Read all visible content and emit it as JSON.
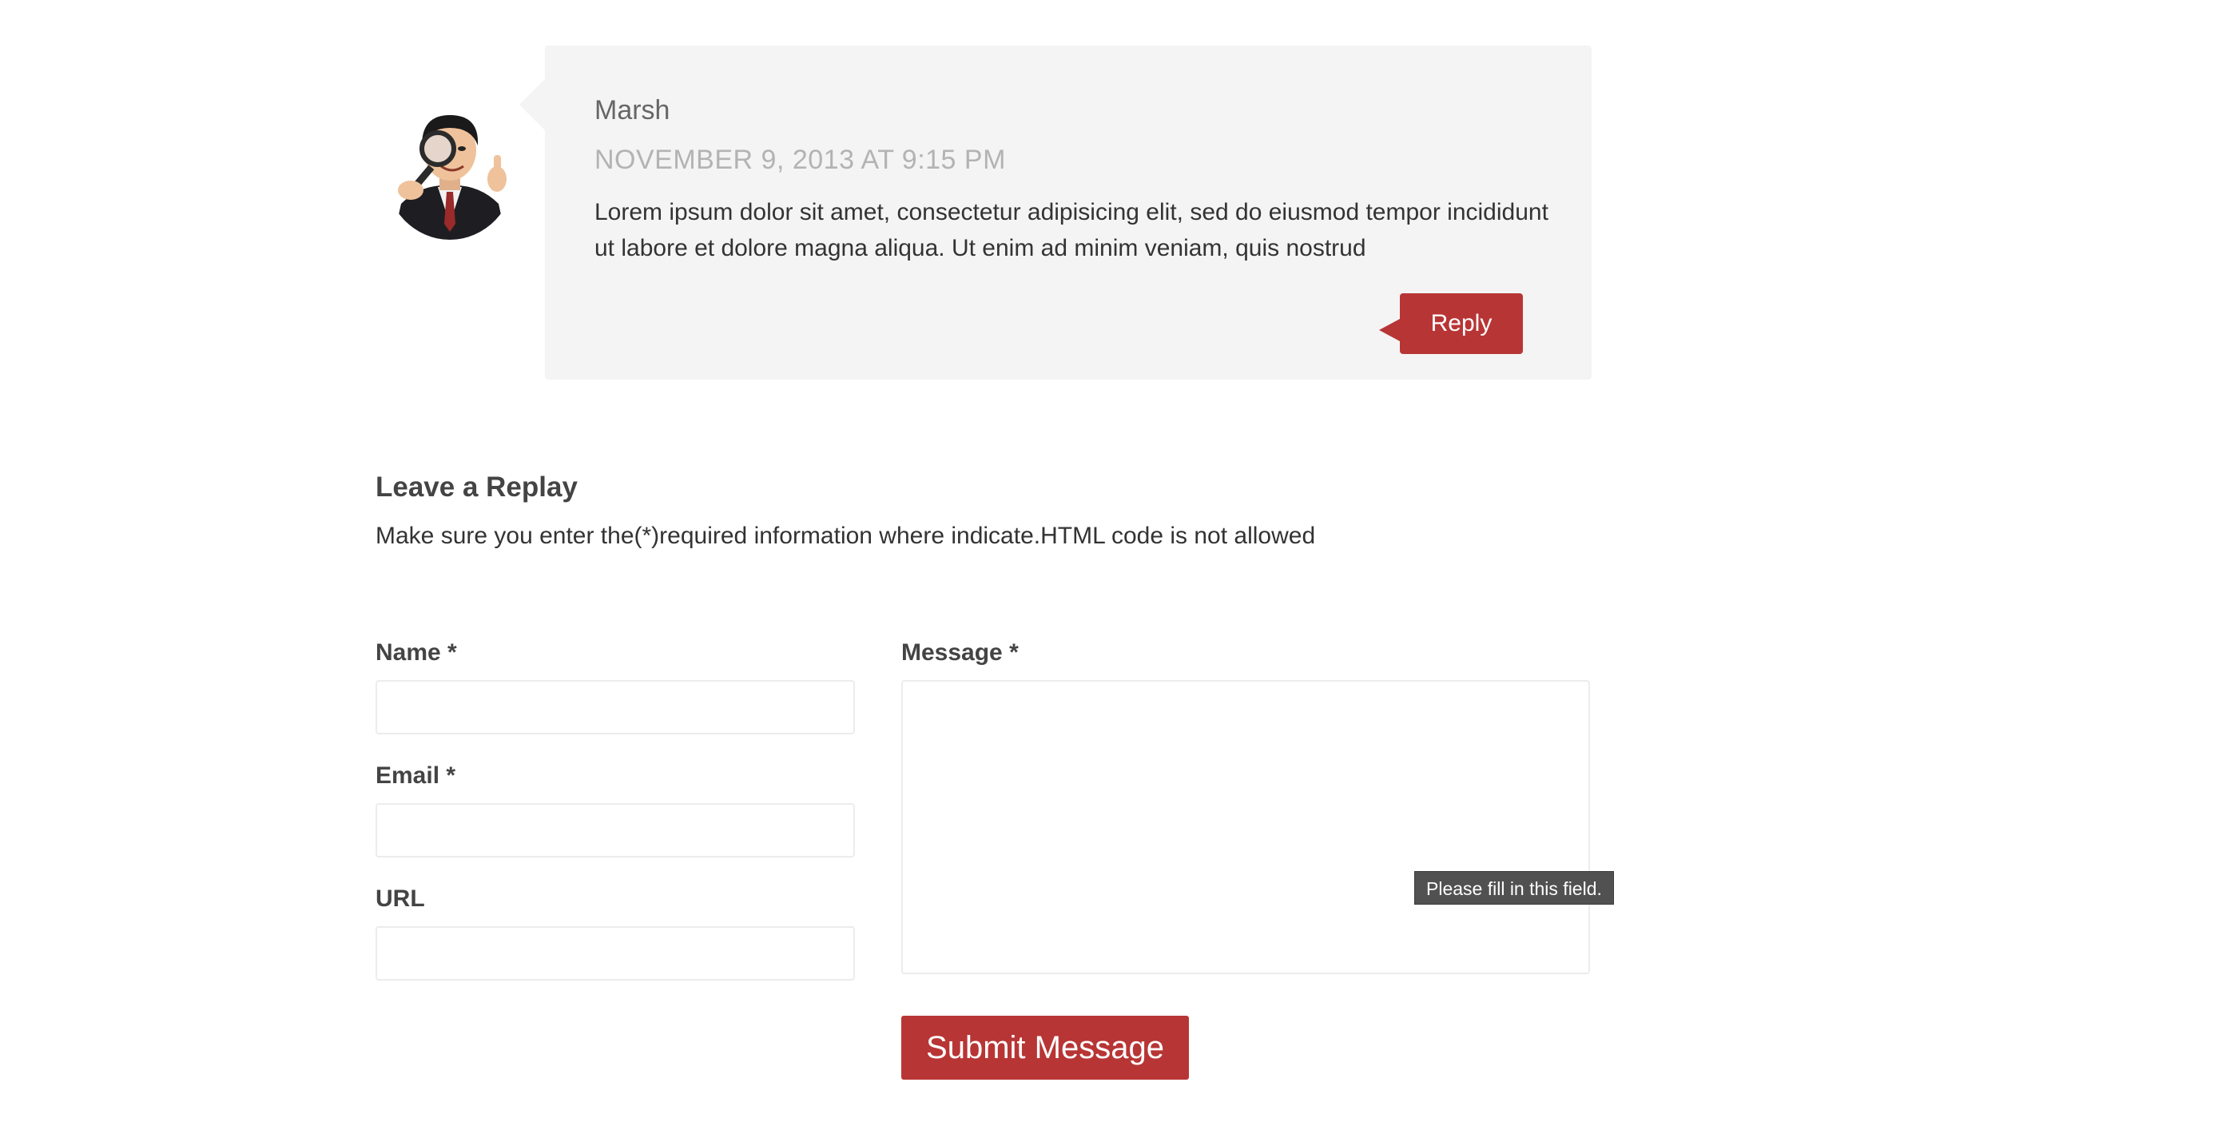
{
  "comment": {
    "avatar_icon": "person-with-magnifying-glass-avatar",
    "author": "Marsh",
    "date": "NOVEMBER 9, 2013 AT 9:15 PM",
    "text": "Lorem ipsum dolor sit amet, consectetur adipisicing elit, sed do eiusmod tempor incididunt ut labore et dolore magna aliqua. Ut enim ad minim veniam, quis nostrud",
    "reply_label": "Reply"
  },
  "form": {
    "title": "Leave a Replay",
    "note": "Make sure you enter the(*)required information where indicate.HTML code is not allowed",
    "name_label": "Name *",
    "name_value": "",
    "email_label": "Email *",
    "email_value": "",
    "url_label": "URL",
    "url_value": "",
    "message_label": "Message *",
    "message_value": "",
    "validation_tooltip": "Please fill in this field.",
    "submit_label": "Submit Message"
  },
  "colors": {
    "accent": "#b83535",
    "comment_background": "#f4f4f4",
    "date_text": "#b3b3b3"
  }
}
